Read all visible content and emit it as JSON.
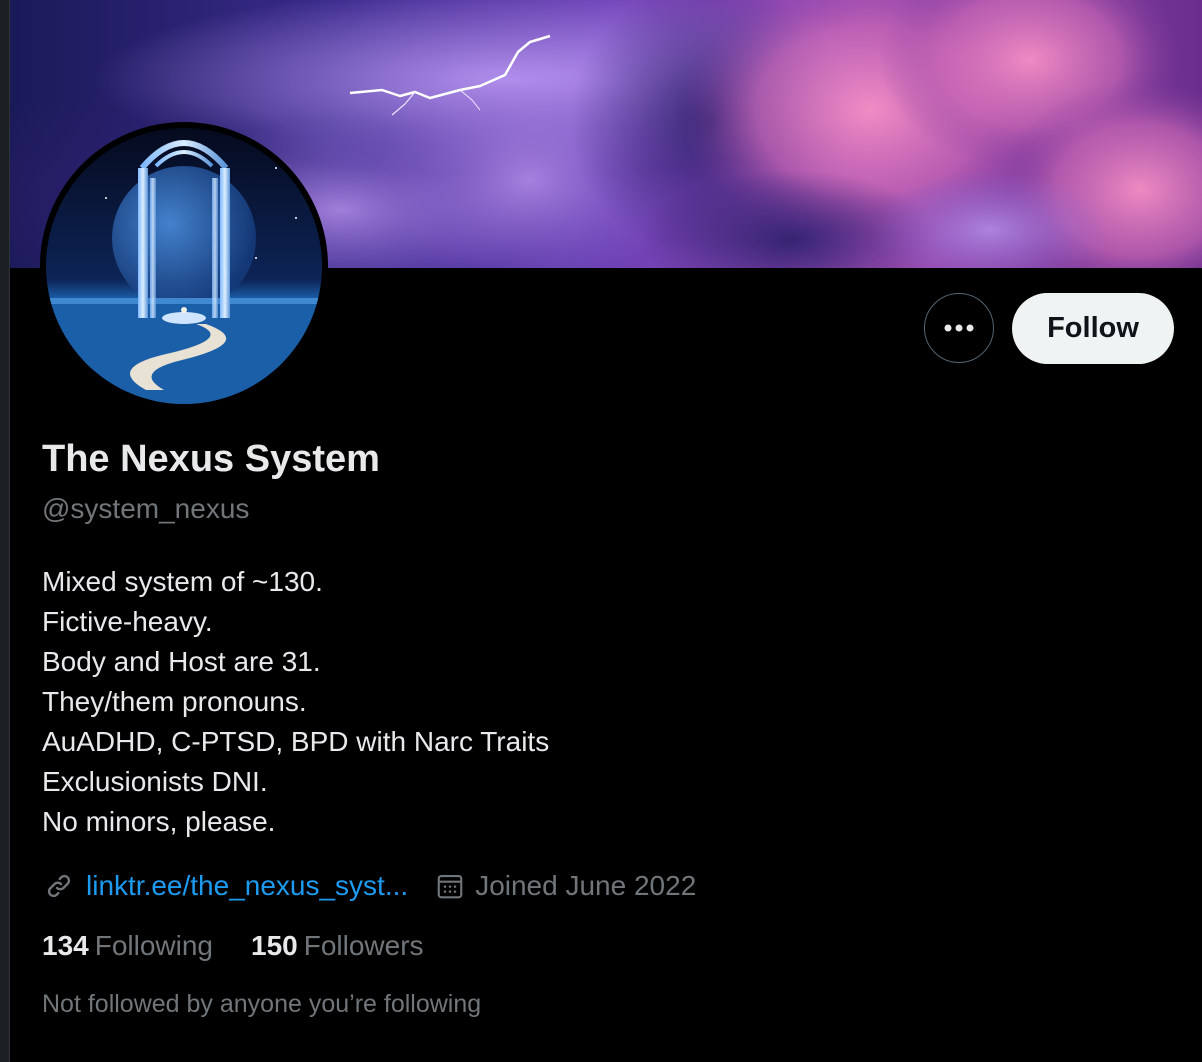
{
  "profile": {
    "display_name": "The Nexus System",
    "handle": "@system_nexus",
    "bio_lines": [
      "Mixed system of ~130.",
      "Fictive-heavy.",
      "Body and Host are 31.",
      "They/them pronouns.",
      "AuADHD, C-PTSD, BPD with Narc Traits",
      "Exclusionists DNI.",
      "No minors, please."
    ],
    "website": "linktr.ee/the_nexus_syst...",
    "joined": "Joined June 2022",
    "following_count": "134",
    "following_label": "Following",
    "followers_count": "150",
    "followers_label": "Followers",
    "mutuals_note": "Not followed by anyone you’re following"
  },
  "actions": {
    "follow_label": "Follow",
    "more_icon": "more-horizontal-icon"
  },
  "icons": {
    "website": "link-icon",
    "joined": "calendar-icon"
  },
  "colors": {
    "background": "#000000",
    "text_primary": "#e7e9ea",
    "text_secondary": "#71767b",
    "link": "#1d9bf0",
    "follow_button_bg": "#eff3f4",
    "follow_button_text": "#0f1419"
  }
}
